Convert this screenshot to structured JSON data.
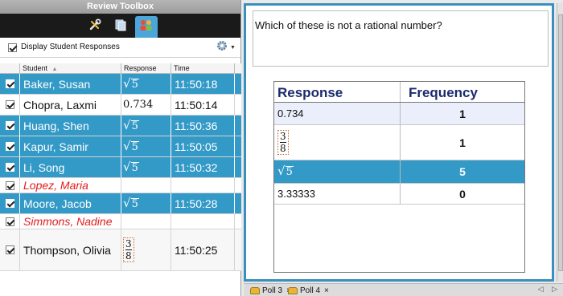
{
  "toolbox": {
    "title": "Review Toolbox",
    "display_label": "Display Student Responses",
    "columns": [
      "Student",
      "Response",
      "Time"
    ]
  },
  "students": [
    {
      "name": "Baker, Susan",
      "response": "√5",
      "time": "11:50:18",
      "state": "selected"
    },
    {
      "name": "Chopra, Laxmi",
      "response": "0.734",
      "time": "11:50:14",
      "state": "plain"
    },
    {
      "name": "Huang, Shen",
      "response": "√5",
      "time": "11:50:36",
      "state": "selected"
    },
    {
      "name": "Kapur, Samir",
      "response": "√5",
      "time": "11:50:05",
      "state": "selected"
    },
    {
      "name": "Li, Song",
      "response": "√5",
      "time": "11:50:32",
      "state": "selected"
    },
    {
      "name": "Lopez, Maria",
      "response": "",
      "time": "",
      "state": "no-response"
    },
    {
      "name": "Moore, Jacob",
      "response": "√5",
      "time": "11:50:28",
      "state": "selected"
    },
    {
      "name": "Simmons, Nadine",
      "response": "",
      "time": "",
      "state": "no-response"
    },
    {
      "name": "Thompson, Olivia",
      "response": "3/8",
      "time": "11:50:25",
      "state": "plain"
    }
  ],
  "math": {
    "sqrt_radicand": "5",
    "frac_num": "3",
    "frac_den": "8"
  },
  "document": {
    "question": "Which of these is not a rational number?",
    "table_headers": [
      "Response",
      "Frequency"
    ],
    "rows": [
      {
        "response": "0.734",
        "frequency": "1"
      },
      {
        "response": "3/8",
        "frequency": "1"
      },
      {
        "response": "√5",
        "frequency": "5"
      },
      {
        "response": "3.33333",
        "frequency": "0"
      }
    ]
  },
  "tabs": [
    {
      "label": "Poll 3",
      "close": "×"
    },
    {
      "label": "Poll 4",
      "close": "×"
    }
  ],
  "nav_arrows": "◁ ▷",
  "colors": {
    "selected": "#3399c7",
    "no_response": "#e21c1c",
    "doc_border": "#3a8fbd"
  }
}
